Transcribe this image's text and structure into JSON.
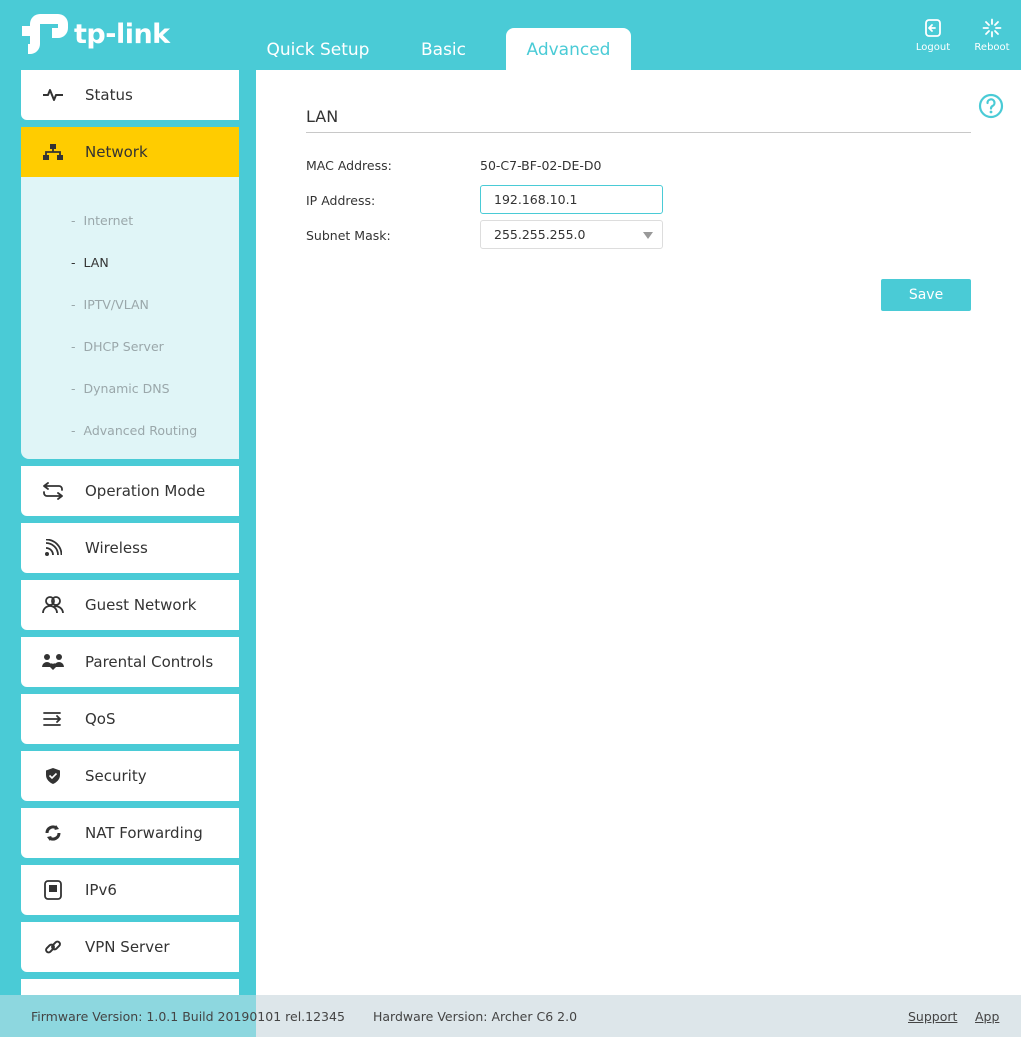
{
  "brand": {
    "name": "tp-link",
    "color": "#4acbd6"
  },
  "header": {
    "tabs": [
      {
        "label": "Quick Setup",
        "active": false
      },
      {
        "label": "Basic",
        "active": false
      },
      {
        "label": "Advanced",
        "active": true
      }
    ],
    "logout_label": "Logout",
    "reboot_label": "Reboot"
  },
  "sidebar": {
    "items": [
      {
        "label": "Status",
        "icon": "pulse-icon"
      },
      {
        "label": "Network",
        "icon": "network-icon",
        "active": true
      },
      {
        "label": "Operation Mode",
        "icon": "swap-icon"
      },
      {
        "label": "Wireless",
        "icon": "wireless-icon"
      },
      {
        "label": "Guest Network",
        "icon": "guests-icon"
      },
      {
        "label": "Parental Controls",
        "icon": "family-icon"
      },
      {
        "label": "QoS",
        "icon": "qos-icon"
      },
      {
        "label": "Security",
        "icon": "shield-icon"
      },
      {
        "label": "NAT Forwarding",
        "icon": "nat-icon"
      },
      {
        "label": "IPv6",
        "icon": "ipv6-icon"
      },
      {
        "label": "VPN Server",
        "icon": "link-icon"
      }
    ],
    "network_submenu": [
      {
        "label": "Internet",
        "active": false
      },
      {
        "label": "LAN",
        "active": true
      },
      {
        "label": "IPTV/VLAN",
        "active": false
      },
      {
        "label": "DHCP Server",
        "active": false
      },
      {
        "label": "Dynamic DNS",
        "active": false
      },
      {
        "label": "Advanced Routing",
        "active": false
      }
    ]
  },
  "main": {
    "title": "LAN",
    "mac_label": "MAC Address:",
    "mac_value": "50-C7-BF-02-DE-D0",
    "ip_label": "IP Address:",
    "ip_value": "192.168.10.1",
    "mask_label": "Subnet Mask:",
    "mask_value": "255.255.255.0",
    "save_label": "Save"
  },
  "footer": {
    "firmware": "Firmware Version: 1.0.1 Build 20190101 rel.12345",
    "hardware": "Hardware Version: Archer C6 2.0",
    "support_label": "Support",
    "app_label": "App"
  }
}
